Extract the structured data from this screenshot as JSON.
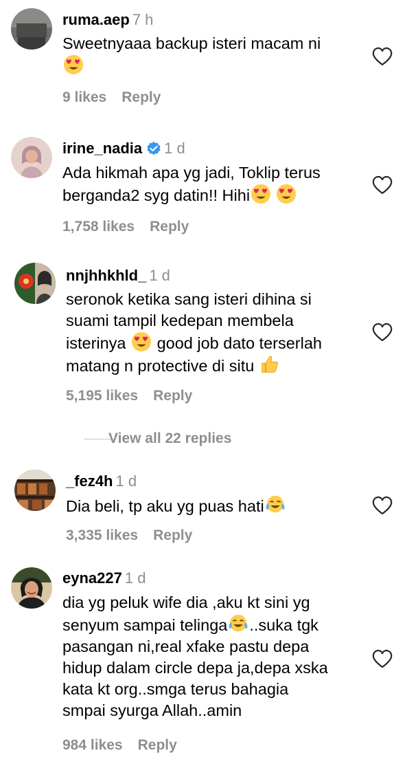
{
  "comments": [
    {
      "username": "ruma.aep",
      "time": "7 h",
      "verified": false,
      "lines": [
        "Sweetnyaaa backup isteri macam ni",
        ""
      ],
      "likes": "9 likes",
      "reply": "Reply"
    },
    {
      "username": "irine_nadia",
      "time": "1 d",
      "verified": true,
      "lines": [
        "Ada hikmah apa yg jadi, Toklip terus",
        "berganda2 syg datin!! Hihi"
      ],
      "likes": "1,758 likes",
      "reply": "Reply"
    },
    {
      "username": "nnjhhkhld_",
      "time": "1 d",
      "verified": false,
      "lines": [
        "seronok ketika sang isteri dihina si",
        "suami tampil kedepan membela",
        "isterinya",
        "good job dato terserlah",
        "matang n protective di situ"
      ],
      "likes": "5,195 likes",
      "reply": "Reply"
    },
    {
      "username": "_fez4h",
      "time": "1 d",
      "verified": false,
      "lines": [
        "Dia beli, tp aku yg puas hati"
      ],
      "likes": "3,335 likes",
      "reply": "Reply"
    },
    {
      "username": "eyna227",
      "time": "1 d",
      "verified": false,
      "lines": [
        "dia yg peluk wife dia ,aku kt sini yg",
        "senyum sampai telinga",
        "..suka tgk",
        "pasangan ni,real xfake pastu depa",
        "hidup dalam circle depa ja,depa xska",
        "kata kt org..smga terus bahagia",
        "smpai syurga Allah..amin"
      ],
      "likes": "984 likes",
      "reply": "Reply"
    }
  ],
  "view_replies": "View all 22 replies",
  "icons": {
    "heart": "heart-outline-icon",
    "verified": "verified-badge-icon",
    "heart_eyes": "heart-eyes-emoji",
    "thumbs_up": "thumbs-up-emoji",
    "tears_of_joy": "tears-of-joy-emoji"
  },
  "colors": {
    "text": "#000000",
    "muted": "#8e8e8e",
    "verified": "#3897f0",
    "emoji": "#ffcc4d"
  }
}
